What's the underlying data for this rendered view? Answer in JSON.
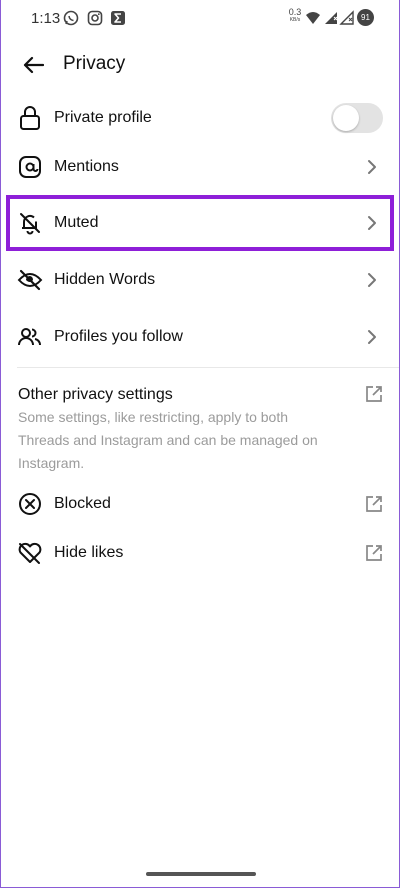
{
  "status_bar": {
    "time": "1:13",
    "net_speed_value": "0.3",
    "net_speed_unit": "KB/s",
    "battery_level": "91"
  },
  "header": {
    "title": "Privacy"
  },
  "rows": [
    {
      "label": "Private profile",
      "icon": "lock-icon",
      "control": "toggle",
      "toggle_on": false
    },
    {
      "label": "Mentions",
      "icon": "at-sign-icon",
      "control": "chevron"
    },
    {
      "label": "Muted",
      "icon": "bell-muted-icon",
      "control": "chevron",
      "highlighted": true
    },
    {
      "label": "Hidden Words",
      "icon": "eye-hidden-icon",
      "control": "chevron"
    },
    {
      "label": "Profiles you follow",
      "icon": "people-icon",
      "control": "chevron"
    }
  ],
  "other_section": {
    "title": "Other privacy settings",
    "description": "Some settings, like restricting, apply to both Threads and Instagram and can be managed on Instagram.",
    "rows": [
      {
        "label": "Blocked",
        "icon": "blocked-icon",
        "control": "external-link"
      },
      {
        "label": "Hide likes",
        "icon": "heart-off-icon",
        "control": "external-link"
      }
    ]
  },
  "colors": {
    "highlight": "#8e1fd8",
    "secondary_text": "#9b9b9b",
    "toggle_off": "#e3e3e3"
  }
}
